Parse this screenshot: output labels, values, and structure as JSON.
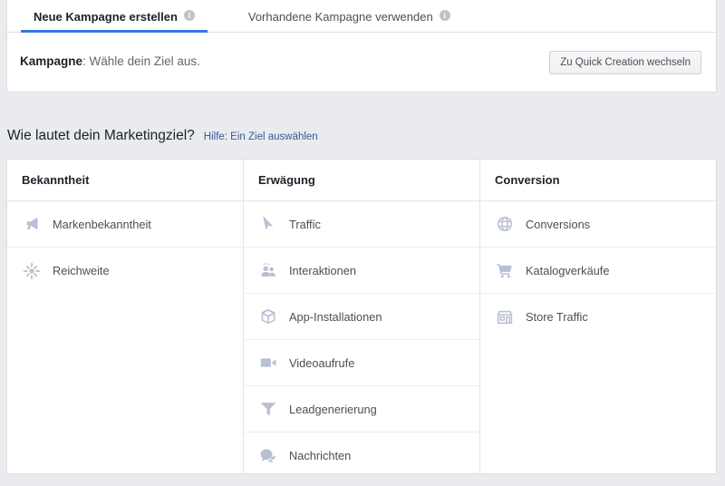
{
  "tabs": [
    {
      "label": "Neue Kampagne erstellen",
      "info": "i",
      "active": true
    },
    {
      "label": "Vorhandene Kampagne verwenden",
      "info": "i",
      "active": false
    }
  ],
  "campaign": {
    "label": "Kampagne",
    "separator": ":",
    "description": " Wähle dein Ziel aus.",
    "quick_creation_button": "Zu Quick Creation wechseln"
  },
  "section": {
    "title": "Wie lautet dein Marketingziel?",
    "help_link": "Hilfe: Ein Ziel auswählen"
  },
  "columns": [
    {
      "header": "Bekanntheit",
      "items": [
        {
          "label": "Markenbekanntheit",
          "icon": "megaphone-icon"
        },
        {
          "label": "Reichweite",
          "icon": "starburst-icon"
        }
      ]
    },
    {
      "header": "Erwägung",
      "items": [
        {
          "label": "Traffic",
          "icon": "cursor-icon"
        },
        {
          "label": "Interaktionen",
          "icon": "people-icon"
        },
        {
          "label": "App-Installationen",
          "icon": "cube-icon"
        },
        {
          "label": "Videoaufrufe",
          "icon": "video-camera-icon"
        },
        {
          "label": "Leadgenerierung",
          "icon": "funnel-icon"
        },
        {
          "label": "Nachrichten",
          "icon": "chat-bubbles-icon"
        }
      ]
    },
    {
      "header": "Conversion",
      "items": [
        {
          "label": "Conversions",
          "icon": "globe-icon"
        },
        {
          "label": "Katalogverkäufe",
          "icon": "shopping-cart-icon"
        },
        {
          "label": "Store Traffic",
          "icon": "storefront-icon"
        }
      ]
    }
  ],
  "colors": {
    "accent": "#3578e5",
    "link": "#3b5998",
    "icon": "#b9bfd4",
    "page_background": "#e9ebee",
    "card_background": "#ffffff"
  }
}
